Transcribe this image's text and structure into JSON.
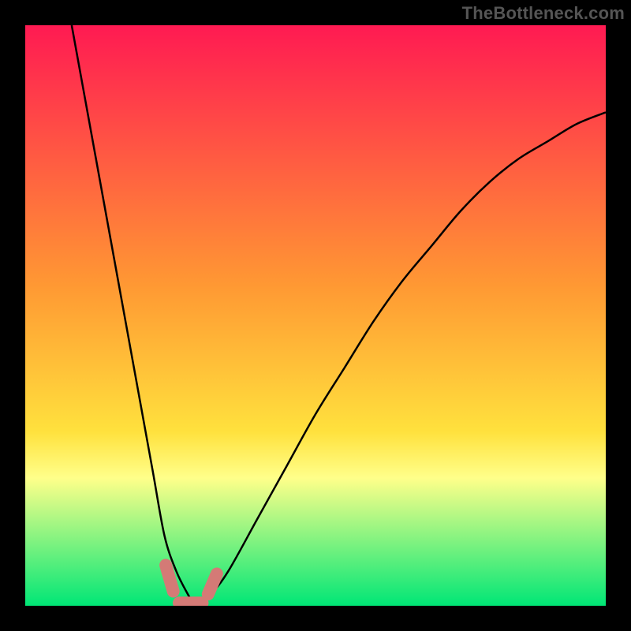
{
  "watermark": "TheBottleneck.com",
  "chart_data": {
    "type": "line",
    "title": "",
    "xlabel": "",
    "ylabel": "",
    "xlim": [
      0,
      100
    ],
    "ylim": [
      0,
      100
    ],
    "background_gradient_colors": [
      "#ff1a52",
      "#ff9933",
      "#ffe13d",
      "#ffff8a",
      "#00e676"
    ],
    "background_gradient_positions": [
      0,
      45,
      70,
      78,
      100
    ],
    "series": [
      {
        "name": "bottleneck-curve",
        "color": "#000000",
        "x": [
          8,
          10,
          12,
          14,
          16,
          18,
          20,
          22,
          24,
          26,
          28,
          29,
          30,
          32,
          35,
          40,
          45,
          50,
          55,
          60,
          65,
          70,
          75,
          80,
          85,
          90,
          95,
          100
        ],
        "y": [
          100,
          89,
          78,
          67,
          56,
          45,
          34,
          23,
          12,
          6,
          2,
          0.5,
          0.5,
          2,
          6,
          15,
          24,
          33,
          41,
          49,
          56,
          62,
          68,
          73,
          77,
          80,
          83,
          85
        ]
      },
      {
        "name": "highlight-left",
        "color": "#d47a76",
        "marker": "rounded-rect",
        "x": [
          24.2,
          25.5
        ],
        "y": [
          7.0,
          2.5
        ]
      },
      {
        "name": "highlight-bottom",
        "color": "#d47a76",
        "marker": "rounded-rect",
        "x": [
          26.5,
          30.5
        ],
        "y": [
          0.5,
          0.5
        ]
      },
      {
        "name": "highlight-right",
        "color": "#d47a76",
        "marker": "rounded-rect",
        "x": [
          31.5,
          33.0
        ],
        "y": [
          2.0,
          5.5
        ]
      }
    ]
  }
}
